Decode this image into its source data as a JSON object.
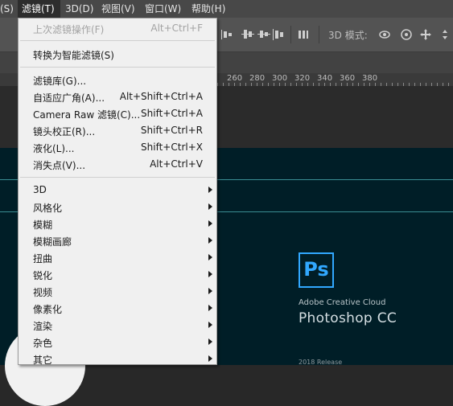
{
  "menubar": {
    "items": [
      "(S)",
      "滤镜(T)",
      "3D(D)",
      "视图(V)",
      "窗口(W)",
      "帮助(H)"
    ]
  },
  "options_bar": {
    "mode_label": "3D 模式:",
    "icons": [
      "align-top-icon",
      "align-vcenter-icon",
      "align-bottom-icon",
      "distribute-icon",
      "3d-rotate-icon",
      "3d-roll-icon",
      "3d-pan-icon",
      "3d-slide-icon",
      "3d-scale-icon"
    ]
  },
  "ruler": {
    "labels": [
      "260",
      "280",
      "300",
      "320",
      "340",
      "360",
      "380"
    ]
  },
  "splash": {
    "logo": "Ps",
    "subtitle": "Adobe Creative Cloud",
    "title": "Photoshop CC",
    "release": "2018 Release"
  },
  "filter_menu": {
    "last_filter": {
      "label": "上次滤镜操作(F)",
      "shortcut": "Alt+Ctrl+F"
    },
    "smart_filter": {
      "label": "转换为智能滤镜(S)"
    },
    "gallery": {
      "label": "滤镜库(G)..."
    },
    "adaptive_wide": {
      "label": "自适应广角(A)...",
      "shortcut": "Alt+Shift+Ctrl+A"
    },
    "camera_raw": {
      "label": "Camera Raw 滤镜(C)...",
      "shortcut": "Shift+Ctrl+A"
    },
    "lens_correction": {
      "label": "镜头校正(R)...",
      "shortcut": "Shift+Ctrl+R"
    },
    "liquify": {
      "label": "液化(L)...",
      "shortcut": "Shift+Ctrl+X"
    },
    "vanishing_point": {
      "label": "消失点(V)...",
      "shortcut": "Alt+Ctrl+V"
    },
    "submenus": [
      "3D",
      "风格化",
      "模糊",
      "模糊画廊",
      "扭曲",
      "锐化",
      "视频",
      "像素化",
      "渲染",
      "杂色",
      "其它"
    ]
  },
  "colors": {
    "menu_bg": "#f0f0f0",
    "canvas_bg": "#001e27",
    "ps_blue": "#31a8ff",
    "guide": "#3a8d93"
  }
}
